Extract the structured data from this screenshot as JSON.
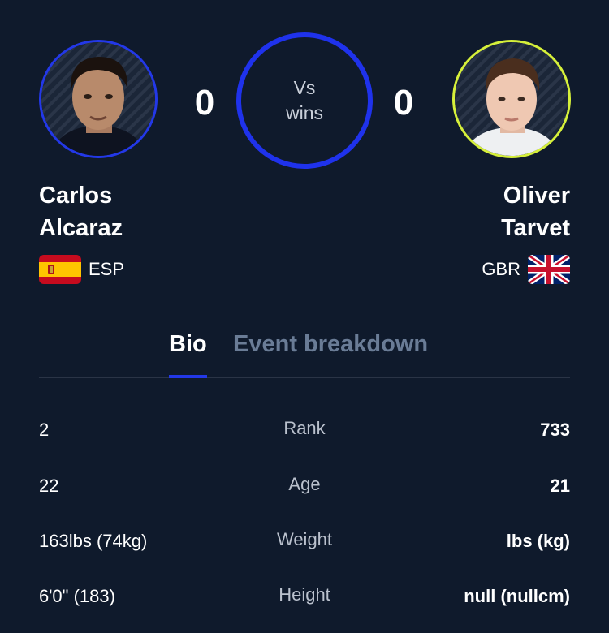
{
  "player_left": {
    "first_name": "Carlos",
    "last_name": "Alcaraz",
    "country": "ESP",
    "score": "0",
    "ring_color": "#2338e8"
  },
  "player_right": {
    "first_name": "Oliver",
    "last_name": "Tarvet",
    "country": "GBR",
    "score": "0",
    "ring_color": "#d6f03a"
  },
  "versus": {
    "line1": "Vs",
    "line2": "wins"
  },
  "tabs": [
    {
      "label": "Bio",
      "active": true
    },
    {
      "label": "Event breakdown",
      "active": false
    }
  ],
  "stats": [
    {
      "label": "Rank",
      "left": "2",
      "right": "733"
    },
    {
      "label": "Age",
      "left": "22",
      "right": "21"
    },
    {
      "label": "Weight",
      "left": "163lbs (74kg)",
      "right": "lbs (kg)"
    },
    {
      "label": "Height",
      "left": "6'0\" (183)",
      "right": "null (nullcm)"
    }
  ],
  "colors": {
    "background": "#0f1a2c",
    "accent_blue": "#1f32ec",
    "tab_inactive": "#6a7c96"
  }
}
